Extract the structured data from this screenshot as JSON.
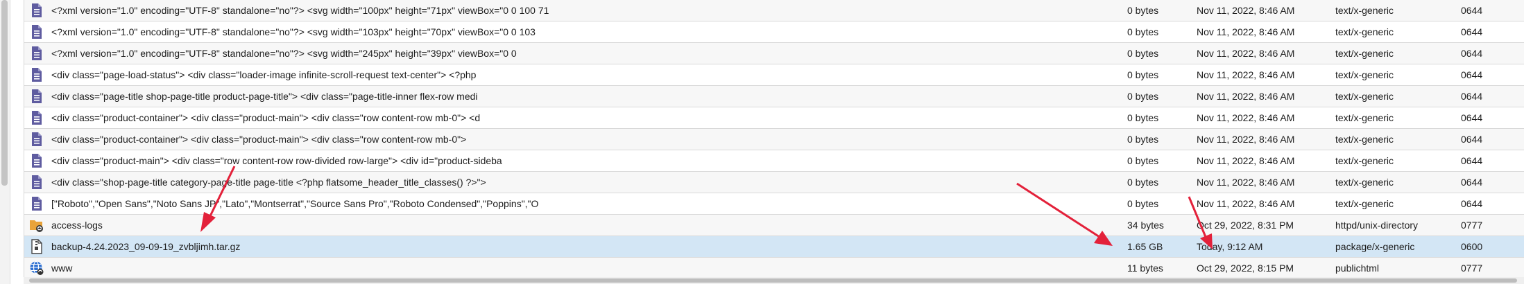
{
  "file_list": {
    "rows": [
      {
        "icon": "text-file-icon",
        "name": "<?xml version=\"1.0\" encoding=\"UTF-8\" standalone=\"no\"?> <svg width=\"100px\" height=\"71px\" viewBox=\"0 0 100 71",
        "size": "0 bytes",
        "modified": "Nov 11, 2022, 8:46 AM",
        "type": "text/x-generic",
        "perms": "0644"
      },
      {
        "icon": "text-file-icon",
        "name": "<?xml version=\"1.0\" encoding=\"UTF-8\" standalone=\"no\"?> <svg width=\"103px\" height=\"70px\" viewBox=\"0 0 103",
        "size": "0 bytes",
        "modified": "Nov 11, 2022, 8:46 AM",
        "type": "text/x-generic",
        "perms": "0644"
      },
      {
        "icon": "text-file-icon",
        "name": "<?xml version=\"1.0\" encoding=\"UTF-8\" standalone=\"no\"?> <svg width=\"245px\" height=\"39px\" viewBox=\"0 0",
        "size": "0 bytes",
        "modified": "Nov 11, 2022, 8:46 AM",
        "type": "text/x-generic",
        "perms": "0644"
      },
      {
        "icon": "text-file-icon",
        "name": "<div class=\"page-load-status\"> <div class=\"loader-image infinite-scroll-request text-center\"> <?php",
        "size": "0 bytes",
        "modified": "Nov 11, 2022, 8:46 AM",
        "type": "text/x-generic",
        "perms": "0644"
      },
      {
        "icon": "text-file-icon",
        "name": "<div class=\"page-title shop-page-title product-page-title\"> <div class=\"page-title-inner flex-row medi",
        "size": "0 bytes",
        "modified": "Nov 11, 2022, 8:46 AM",
        "type": "text/x-generic",
        "perms": "0644"
      },
      {
        "icon": "text-file-icon",
        "name": "<div class=\"product-container\"> <div class=\"product-main\"> <div class=\"row content-row mb-0\"> <d",
        "size": "0 bytes",
        "modified": "Nov 11, 2022, 8:46 AM",
        "type": "text/x-generic",
        "perms": "0644"
      },
      {
        "icon": "text-file-icon",
        "name": "<div class=\"product-container\"> <div class=\"product-main\"> <div class=\"row content-row mb-0\">",
        "size": "0 bytes",
        "modified": "Nov 11, 2022, 8:46 AM",
        "type": "text/x-generic",
        "perms": "0644"
      },
      {
        "icon": "text-file-icon",
        "name": "<div class=\"product-main\"> <div class=\"row content-row row-divided row-large\"> <div id=\"product-sideba",
        "size": "0 bytes",
        "modified": "Nov 11, 2022, 8:46 AM",
        "type": "text/x-generic",
        "perms": "0644"
      },
      {
        "icon": "text-file-icon",
        "name": "<div class=\"shop-page-title category-page-title page-title <?php flatsome_header_title_classes() ?>\">",
        "size": "0 bytes",
        "modified": "Nov 11, 2022, 8:46 AM",
        "type": "text/x-generic",
        "perms": "0644"
      },
      {
        "icon": "text-file-icon",
        "name": "[\"Roboto\",\"Open Sans\",\"Noto Sans JP\",\"Lato\",\"Montserrat\",\"Source Sans Pro\",\"Roboto Condensed\",\"Poppins\",\"O",
        "size": "0 bytes",
        "modified": "Nov 11, 2022, 8:46 AM",
        "type": "text/x-generic",
        "perms": "0644"
      },
      {
        "icon": "folder-link-icon",
        "name": "access-logs",
        "size": "34 bytes",
        "modified": "Oct 29, 2022, 8:31 PM",
        "type": "httpd/unix-directory",
        "perms": "0777"
      },
      {
        "icon": "archive-file-icon",
        "name": "backup-4.24.2023_09-09-19_zvbljimh.tar.gz",
        "size": "1.65 GB",
        "modified": "Today, 9:12 AM",
        "type": "package/x-generic",
        "perms": "0600",
        "selected": true
      },
      {
        "icon": "globe-link-icon",
        "name": "www",
        "size": "11 bytes",
        "modified": "Oct 29, 2022, 8:15 PM",
        "type": "publichtml",
        "perms": "0777"
      }
    ]
  },
  "colors": {
    "selected_row": "#d3e6f5",
    "file_icon": "#5f5ca0",
    "folder_icon": "#e8a33a",
    "globe_icon": "#2d6fd1",
    "annotation_arrow": "#e3213a"
  }
}
